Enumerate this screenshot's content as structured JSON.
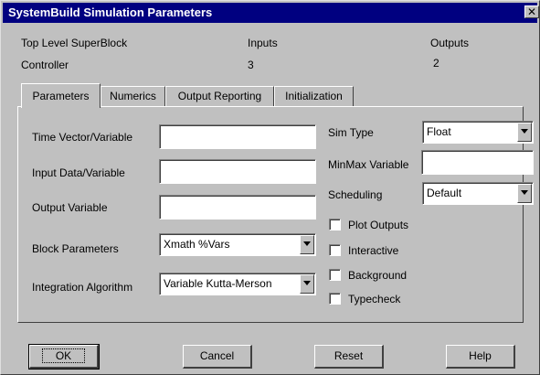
{
  "window": {
    "title": "SystemBuild Simulation Parameters",
    "close_glyph": "✕"
  },
  "info": {
    "header_left": "Top Level SuperBlock",
    "header_inputs": "Inputs",
    "header_outputs": "Outputs",
    "block_name": "Controller",
    "inputs_value": "3",
    "outputs_value": "2"
  },
  "tabs": [
    {
      "label": "Parameters",
      "active": true
    },
    {
      "label": "Numerics",
      "active": false
    },
    {
      "label": "Output Reporting",
      "active": false
    },
    {
      "label": "Initialization",
      "active": false
    }
  ],
  "params": {
    "time_vector_label": "Time Vector/Variable",
    "time_vector_value": "",
    "input_data_label": "Input Data/Variable",
    "input_data_value": "",
    "output_variable_label": "Output Variable",
    "output_variable_value": "",
    "block_parameters_label": "Block Parameters",
    "block_parameters_value": "Xmath %Vars",
    "integration_label": "Integration Algorithm",
    "integration_value": "Variable Kutta-Merson",
    "sim_type_label": "Sim Type",
    "sim_type_value": "Float",
    "minmax_label": "MinMax Variable",
    "minmax_value": "",
    "scheduling_label": "Scheduling",
    "scheduling_value": "Default"
  },
  "checkboxes": [
    {
      "label": "Plot Outputs",
      "checked": false
    },
    {
      "label": "Interactive",
      "checked": false
    },
    {
      "label": "Background",
      "checked": false
    },
    {
      "label": "Typecheck",
      "checked": false
    }
  ],
  "buttons": {
    "ok": "OK",
    "cancel": "Cancel",
    "reset": "Reset",
    "help": "Help"
  }
}
